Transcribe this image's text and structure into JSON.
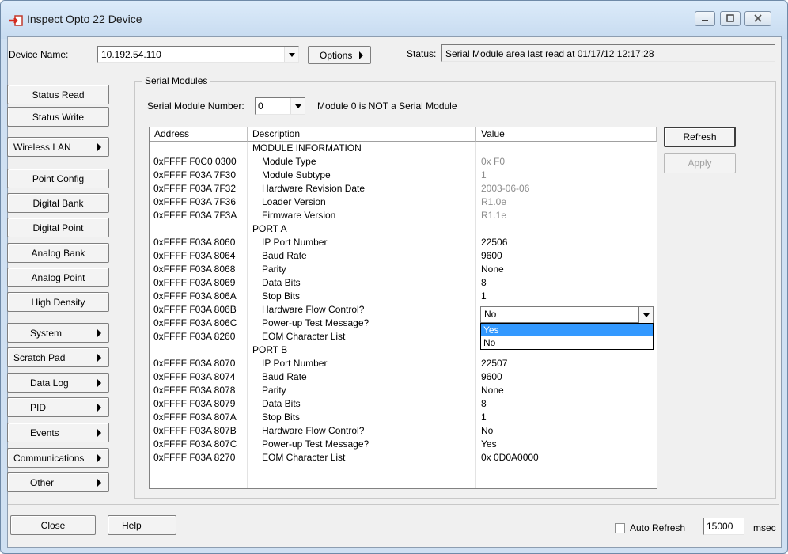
{
  "window": {
    "title": "Inspect Opto 22 Device",
    "controls": [
      "minimize-icon",
      "maximize-icon",
      "close-icon"
    ]
  },
  "toolbar": {
    "device_label": "Device Name:",
    "device_value": "10.192.54.110",
    "options_label": "Options",
    "status_label": "Status:",
    "status_value": "Serial Module area last read at 01/17/12 12:17:28"
  },
  "sidebar": {
    "buttons": [
      {
        "label": "Status Read",
        "submenu": false
      },
      {
        "label": "Status Write",
        "submenu": false
      },
      {
        "label": "Wireless LAN",
        "submenu": true
      },
      {
        "label": "Point Config",
        "submenu": false
      },
      {
        "label": "Digital Bank",
        "submenu": false
      },
      {
        "label": "Digital Point",
        "submenu": false
      },
      {
        "label": "Analog Bank",
        "submenu": false
      },
      {
        "label": "Analog Point",
        "submenu": false
      },
      {
        "label": "High Density",
        "submenu": false
      },
      {
        "label": "System",
        "submenu": true
      },
      {
        "label": "Scratch Pad",
        "submenu": true
      },
      {
        "label": "Data Log",
        "submenu": true
      },
      {
        "label": "PID",
        "submenu": true
      },
      {
        "label": "Events",
        "submenu": true
      },
      {
        "label": "Communications",
        "submenu": true
      },
      {
        "label": "Other",
        "submenu": true
      }
    ]
  },
  "serial": {
    "group_title": "Serial Modules",
    "module_number_label": "Serial Module Number:",
    "module_number_value": "0",
    "module_note": "Module 0 is NOT a Serial Module"
  },
  "table": {
    "columns": [
      "Address",
      "Description",
      "Value"
    ],
    "rows": [
      {
        "type": "header",
        "desc": "MODULE INFORMATION"
      },
      {
        "address": "0xFFFF F0C0 0300",
        "desc": "Module Type",
        "value": "0x F0",
        "muted": true
      },
      {
        "address": "0xFFFF F03A 7F30",
        "desc": "Module Subtype",
        "value": "1",
        "muted": true
      },
      {
        "address": "0xFFFF F03A 7F32",
        "desc": "Hardware Revision Date",
        "value": "2003-06-06",
        "muted": true
      },
      {
        "address": "0xFFFF F03A 7F36",
        "desc": "Loader Version",
        "value": "R1.0e",
        "muted": true
      },
      {
        "address": "0xFFFF F03A 7F3A",
        "desc": "Firmware Version",
        "value": "R1.1e",
        "muted": true
      },
      {
        "type": "header",
        "desc": "PORT A"
      },
      {
        "address": "0xFFFF F03A 8060",
        "desc": "IP Port Number",
        "value": "22506"
      },
      {
        "address": "0xFFFF F03A 8064",
        "desc": "Baud Rate",
        "value": "9600"
      },
      {
        "address": "0xFFFF F03A 8068",
        "desc": "Parity",
        "value": "None"
      },
      {
        "address": "0xFFFF F03A 8069",
        "desc": "Data Bits",
        "value": "8"
      },
      {
        "address": "0xFFFF F03A 806A",
        "desc": "Stop Bits",
        "value": "1"
      },
      {
        "address": "0xFFFF F03A 806B",
        "desc": "Hardware Flow Control?",
        "value": ""
      },
      {
        "address": "0xFFFF F03A 806C",
        "desc": "Power-up Test Message?",
        "value": ""
      },
      {
        "address": "0xFFFF F03A 8260",
        "desc": "EOM Character List",
        "value": ""
      },
      {
        "type": "header",
        "desc": "PORT B"
      },
      {
        "address": "0xFFFF F03A 8070",
        "desc": "IP Port Number",
        "value": "22507"
      },
      {
        "address": "0xFFFF F03A 8074",
        "desc": "Baud Rate",
        "value": "9600"
      },
      {
        "address": "0xFFFF F03A 8078",
        "desc": "Parity",
        "value": "None"
      },
      {
        "address": "0xFFFF F03A 8079",
        "desc": "Data Bits",
        "value": "8"
      },
      {
        "address": "0xFFFF F03A 807A",
        "desc": "Stop Bits",
        "value": "1"
      },
      {
        "address": "0xFFFF F03A 807B",
        "desc": "Hardware Flow Control?",
        "value": "No"
      },
      {
        "address": "0xFFFF F03A 807C",
        "desc": "Power-up Test Message?",
        "value": "Yes"
      },
      {
        "address": "0xFFFF F03A 8270",
        "desc": "EOM Character List",
        "value": "0x 0D0A0000"
      }
    ],
    "dropdown": {
      "value": "No",
      "options": [
        "Yes",
        "No"
      ],
      "highlighted": "Yes"
    }
  },
  "actions": {
    "refresh": "Refresh",
    "apply": "Apply"
  },
  "footer": {
    "close": "Close",
    "help": "Help",
    "auto_refresh_label": "Auto Refresh",
    "auto_refresh_checked": false,
    "interval_value": "15000",
    "interval_unit": "msec"
  },
  "colors": {
    "selection": "#3399ff",
    "muted_text": "#8c8c8c",
    "window_frame": "#cfe0f2"
  }
}
